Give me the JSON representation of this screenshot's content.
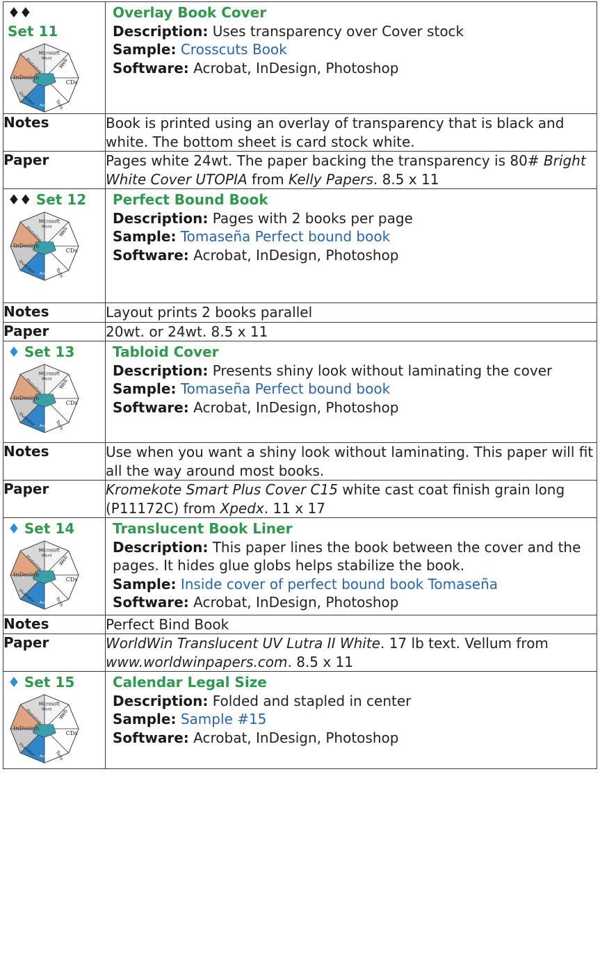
{
  "wheel_labels": [
    "Microsoft Word",
    "Web",
    "CDs",
    "Tools",
    "Acrobat",
    "Illustrator",
    "InDesign",
    "Photoshop"
  ],
  "colors": {
    "green_heading": "#2e9a4c",
    "link_blue": "#2466b4",
    "diamond_blue": "#2a8fd6"
  },
  "sets": [
    {
      "diamonds": "♦♦",
      "set_label": "Set 11",
      "title": "Overlay Book Cover",
      "description_label": "Description:",
      "description": "Uses transparency over Cover stock",
      "sample_label": "Sample:",
      "sample": "Crosscuts Book",
      "software_label": "Software:",
      "software": "Acrobat, InDesign, Photoshop",
      "notes_label": "Notes",
      "notes": "Book is printed using  an overlay of transparency that is black and white. The bottom sheet is card stock white.",
      "paper_label": "Paper",
      "paper": [
        "Pages white 24wt. The paper backing the transparency is 80# ",
        "Bright White Cover UTOPIA",
        " from ",
        "Kelly Papers",
        ".  8.5 x 11"
      ]
    },
    {
      "diamonds": "♦♦",
      "set_label": "Set 12",
      "title": "Perfect Bound Book",
      "description_label": "Description:",
      "description": "Pages with 2 books per page",
      "sample_label": "Sample:",
      "sample": "Tomaseña Perfect bound book",
      "software_label": "Software:",
      "software": "Acrobat, InDesign, Photoshop",
      "notes_label": "Notes",
      "notes": "Layout prints 2 books parallel",
      "paper_label": "Paper",
      "paper": "20wt. or 24wt. 8.5 x 11"
    },
    {
      "diamonds": "♦",
      "set_label": "Set 13",
      "title": "Tabloid Cover",
      "description_label": "Description:",
      "description": "Presents shiny look without laminating the cover",
      "sample_label": "Sample:",
      "sample": "Tomaseña Perfect bound book",
      "software_label": "Software:",
      "software": "Acrobat, InDesign, Photoshop",
      "notes_label": "Notes",
      "notes": "Use when you want a shiny look without laminating. This paper will fit all the way around most books.",
      "paper_label": "Paper",
      "paper": [
        "Kromekote Smart Plus Cover C15",
        " white cast coat finish grain long  (P11172C) from ",
        "Xpedx",
        ". 11 x 17"
      ]
    },
    {
      "diamonds": "♦",
      "set_label": "Set 14",
      "title": "Translucent Book Liner",
      "description_label": "Description:",
      "description": "This paper lines the book between the cover and the pages. It hides glue globs helps stabilize the book.",
      "sample_label": "Sample:",
      "sample": "Inside cover of perfect bound book Tomaseña",
      "software_label": "Software:",
      "software": "Acrobat, InDesign, Photoshop",
      "notes_label": "Notes",
      "notes": "Perfect Bind Book",
      "paper_label": "Paper",
      "paper": [
        "WorldWin Translucent  UV Lutra II White",
        ". 17 lb text. Vellum from ",
        "www.worldwinpapers.com",
        ". 8.5 x 11"
      ]
    },
    {
      "diamonds": "♦",
      "set_label": "Set 15",
      "title": "Calendar Legal Size",
      "description_label": "Description:",
      "description": "Folded and stapled in center",
      "sample_label": "Sample:",
      "sample": "Sample #15",
      "software_label": "Software:",
      "software": "Acrobat, InDesign, Photoshop"
    }
  ]
}
